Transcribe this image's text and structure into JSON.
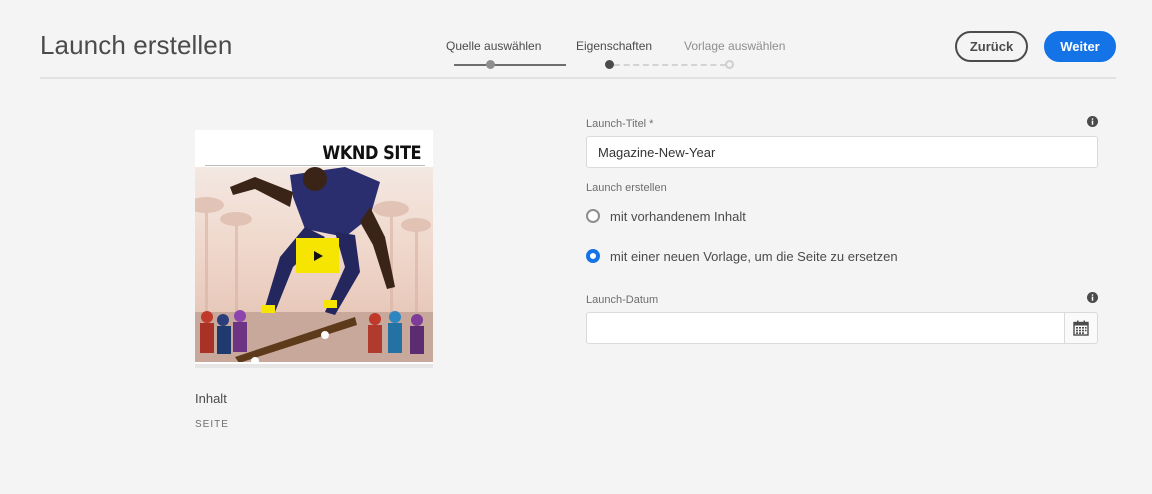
{
  "header": {
    "title": "Launch erstellen",
    "back_label": "Zurück",
    "next_label": "Weiter"
  },
  "wizard": {
    "steps": [
      {
        "label": "Quelle auswählen",
        "state": "done"
      },
      {
        "label": "Eigenschaften",
        "state": "current"
      },
      {
        "label": "Vorlage auswählen",
        "state": "todo"
      }
    ]
  },
  "source_card": {
    "brand": "WKND SITE",
    "name": "Inhalt",
    "type": "SEITE"
  },
  "form": {
    "title_label": "Launch-Titel *",
    "title_value": "Magazine-New-Year",
    "create_label": "Launch erstellen",
    "options": [
      {
        "label": "mit vorhandenem Inhalt",
        "checked": false
      },
      {
        "label": "mit einer neuen Vorlage, um die Seite zu ersetzen",
        "checked": true
      }
    ],
    "date_label": "Launch-Datum",
    "date_value": ""
  },
  "colors": {
    "accent": "#1473e6",
    "text": "#4b4b4b",
    "background": "#f4f4f4",
    "play_button": "#f5e500"
  },
  "icons": [
    "info-icon",
    "calendar-icon",
    "play-icon"
  ]
}
